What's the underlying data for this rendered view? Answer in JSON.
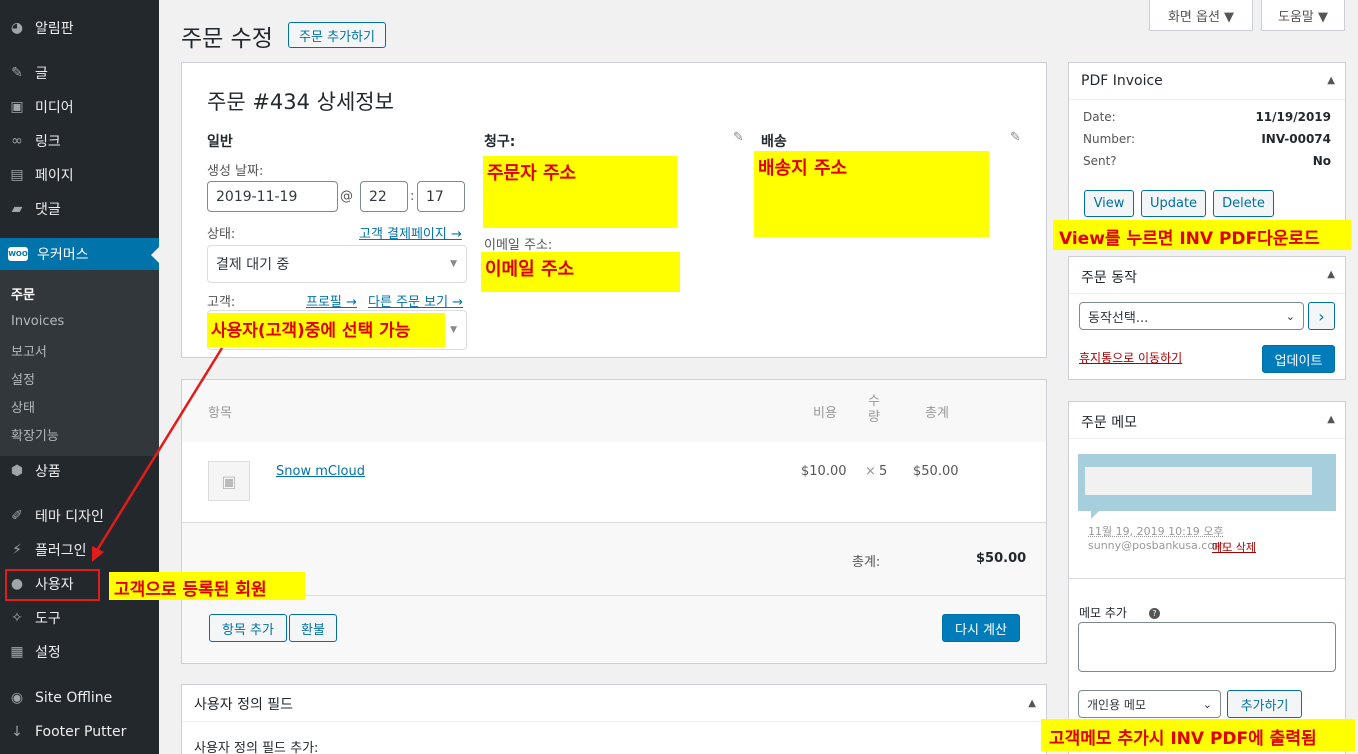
{
  "sidebar": {
    "dashboard": "알림판",
    "posts": "글",
    "media": "미디어",
    "links": "링크",
    "pages": "페이지",
    "comments": "댓글",
    "woocommerce": "우커머스",
    "woo_badge": "WOO",
    "sub": [
      "주문",
      "Invoices",
      "보고서",
      "설정",
      "상태",
      "확장기능"
    ],
    "products": "상품",
    "appearance": "테마 디자인",
    "plugins": "플러그인",
    "users": "사용자",
    "tools": "도구",
    "settings": "설정",
    "site_offline": "Site Offline",
    "footer_putter": "Footer Putter"
  },
  "header": {
    "title": "주문 수정",
    "add_order": "주문 추가하기",
    "screen_options": "화면 옵션 ▼",
    "help": "도움말 ▼"
  },
  "order": {
    "heading": "주문 #434 상세정보",
    "general": "일반",
    "created_date_label": "생성 날짜:",
    "date": "2019-11-19",
    "at": "@",
    "hour": "22",
    "colon": ":",
    "minute": "17",
    "status_label": "상태:",
    "customer_payment_link": "고객 결제페이지 →",
    "status_value": "결제 대기 중",
    "customer_label": "고객:",
    "profile_link": "프로필 →",
    "other_orders_link": "다른 주문 보기 →",
    "billing": "청구:",
    "email_label": "이메일 주소:",
    "shipping": "배송",
    "ann_customer_select": "사용자(고객)중에 선택 가능",
    "ann_billing": "주문자 주소",
    "ann_email": "이메일 주소",
    "ann_shipping": "배송지 주소"
  },
  "items": {
    "col_item": "항목",
    "col_cost": "비용",
    "col_qty": "수량",
    "col_total": "총계",
    "rows": [
      {
        "name": "Snow mCloud",
        "cost": "$10.00",
        "times": "×",
        "qty": "5",
        "total": "$50.00"
      }
    ],
    "subtotal_label": "총계:",
    "subtotal_value": "$50.00",
    "add_item": "항목 추가",
    "refund": "환불",
    "recalculate": "다시 계산"
  },
  "custom_fields": {
    "title": "사용자 정의 필드",
    "add_label": "사용자 정의 필드 추가:"
  },
  "pdf_invoice": {
    "title": "PDF Invoice",
    "date_label": "Date:",
    "date_value": "11/19/2019",
    "number_label": "Number:",
    "number_value": "INV-00074",
    "sent_label": "Sent?",
    "sent_value": "No",
    "view": "View",
    "update": "Update",
    "delete": "Delete",
    "annotation": "View를 누르면 INV PDF다운로드"
  },
  "order_actions": {
    "title": "주문 동작",
    "select_value": "동작선택...",
    "go": "›",
    "trash_link": "휴지통으로 이동하기",
    "update_button": "업데이트"
  },
  "order_notes": {
    "title": "주문 메모",
    "note_date": "11월 19, 2019 10:19 오후",
    "note_author": "sunny@posbankusa.com",
    "delete_note": "메모 삭제",
    "add_note_label": "메모 추가",
    "help_icon": "?",
    "note_type": "개인용 메모",
    "add_button": "추가하기",
    "annotation": "고객메모 추가시 INV PDF에 출력됨"
  },
  "annotations": {
    "users_note": "고객으로 등록된 회원"
  },
  "colors": {
    "sidebar_bg": "#23282d",
    "accent": "#0073aa",
    "highlight": "#ffff00",
    "annotation_text": "#e00000"
  }
}
